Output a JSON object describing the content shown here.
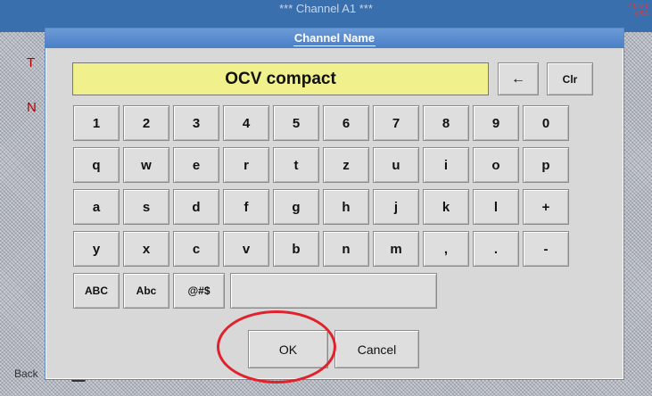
{
  "background": {
    "title": "*** Channel A1 ***",
    "corner_lines": [
      "< 0.0 s",
      "VSA"
    ],
    "side_letters": [
      "T",
      "N"
    ],
    "bottom_label": "Back"
  },
  "dialog": {
    "title": "Channel Name"
  },
  "display": {
    "value": "OCV compact"
  },
  "top_keys": {
    "backspace": "←",
    "clear": "Clr"
  },
  "keyboard": {
    "row1": [
      "1",
      "2",
      "3",
      "4",
      "5",
      "6",
      "7",
      "8",
      "9",
      "0"
    ],
    "row2": [
      "q",
      "w",
      "e",
      "r",
      "t",
      "z",
      "u",
      "i",
      "o",
      "p"
    ],
    "row3": [
      "a",
      "s",
      "d",
      "f",
      "g",
      "h",
      "j",
      "k",
      "l",
      "+"
    ],
    "row4": [
      "y",
      "x",
      "c",
      "v",
      "b",
      "n",
      "m",
      ",",
      ".",
      "-"
    ],
    "row5": [
      "ABC",
      "Abc",
      "@#$",
      ""
    ]
  },
  "buttons": {
    "ok": "OK",
    "cancel": "Cancel"
  },
  "colors": {
    "header_blue": "#4a7fc6",
    "display_yellow": "#f0f08c",
    "highlight_red": "#e1212b"
  }
}
